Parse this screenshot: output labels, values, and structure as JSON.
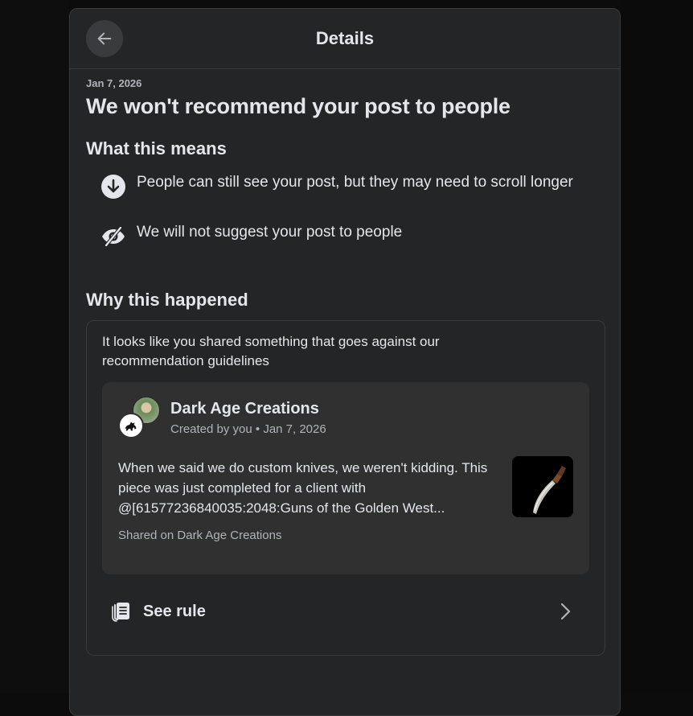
{
  "header": {
    "title": "Details",
    "back_icon": "arrow-left-icon"
  },
  "notice": {
    "date": "Jan 7, 2026",
    "heading": "We won't recommend your post to people"
  },
  "what_this_means": {
    "heading": "What this means",
    "items": [
      {
        "icon": "arrow-down-circle-icon",
        "text": "People can still see your post, but they may need to scroll longer"
      },
      {
        "icon": "eye-slash-icon",
        "text": "We will not suggest your post to people"
      }
    ]
  },
  "why": {
    "heading": "Why this happened",
    "text": "It looks like you shared something that goes against our recommendation guidelines",
    "post": {
      "page_name": "Dark Age Creations",
      "meta": "Created by you • Jan 7, 2026",
      "body": "When we said we do custom knives, we weren't kidding. This piece was just completed for a client with @[61577236840035:2048:Guns of the Golden West...",
      "shared_on": "Shared on Dark Age Creations",
      "thumbnail": "knife-photo"
    },
    "rule_link": {
      "label": "See rule",
      "icon": "rulebook-icon"
    }
  },
  "colors": {
    "background": "#0c0c0c",
    "dialog": "#242526",
    "card": "#303031",
    "text_primary": "#e4e6eb",
    "text_secondary": "#b0b3b8"
  }
}
